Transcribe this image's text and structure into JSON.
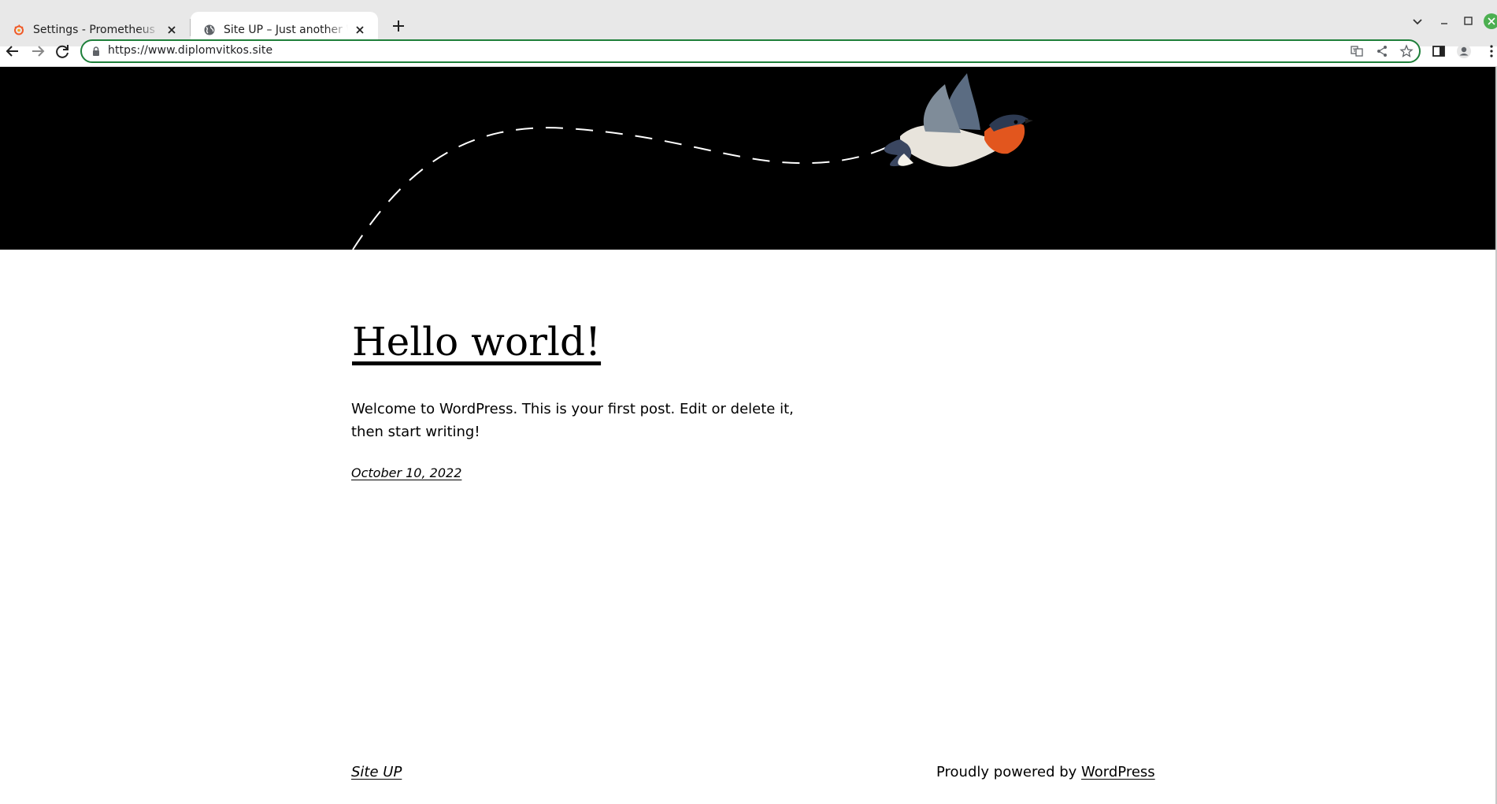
{
  "browser": {
    "tabs": [
      {
        "title": "Settings - Prometheus - Data s",
        "favicon": "grafana-icon",
        "active": false
      },
      {
        "title": "Site UP – Just another WordPr",
        "favicon": "globe-icon",
        "active": true
      }
    ],
    "url": "https://www.diplomvitkos.site",
    "accent_color": "#1e7f3a"
  },
  "page": {
    "hero": {
      "background": "#000000",
      "illustration": "bird-flight-icon"
    },
    "post": {
      "title": "Hello world!",
      "body": "Welcome to WordPress. This is your first post. Edit or delete it, then start writing!",
      "date": "October 10, 2022"
    },
    "footer": {
      "site_name": "Site UP",
      "powered_prefix": "Proudly powered by ",
      "powered_link": "WordPress"
    }
  }
}
